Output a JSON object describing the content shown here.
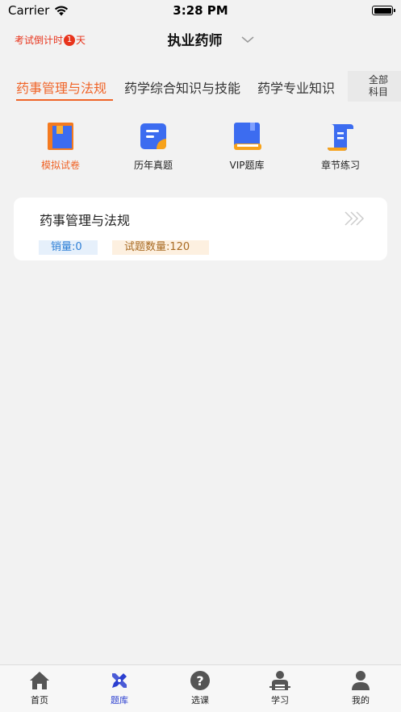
{
  "status_bar": {
    "carrier": "Carrier",
    "time": "3:28 PM"
  },
  "header": {
    "countdown_prefix": "考试倒计时",
    "countdown_days": "1",
    "countdown_suffix": "天",
    "title": "执业药师",
    "accent_color": "#e8341c"
  },
  "tabs": {
    "items": [
      {
        "label": "药事管理与法规",
        "active": true
      },
      {
        "label": "药学综合知识与技能",
        "active": false
      },
      {
        "label": "药学专业知识",
        "active": false
      }
    ],
    "all_subjects_line1": "全部",
    "all_subjects_line2": "科目",
    "active_color": "#f06428"
  },
  "features": [
    {
      "label": "模拟试卷",
      "icon": "mock-exam-icon"
    },
    {
      "label": "历年真题",
      "icon": "past-exams-icon"
    },
    {
      "label": "VIP题库",
      "icon": "vip-bank-icon"
    },
    {
      "label": "章节练习",
      "icon": "chapter-practice-icon"
    }
  ],
  "card": {
    "title": "药事管理与法规",
    "sales": "销量:0",
    "question_count": "试题数量:120"
  },
  "tabbar": {
    "items": [
      {
        "label": "首页",
        "icon": "home-icon",
        "active": false
      },
      {
        "label": "题库",
        "icon": "question-bank-icon",
        "active": true
      },
      {
        "label": "选课",
        "icon": "question-mark-icon",
        "active": false
      },
      {
        "label": "学习",
        "icon": "study-icon",
        "active": false
      },
      {
        "label": "我的",
        "icon": "profile-icon",
        "active": false
      }
    ],
    "active_color": "#2b3fd0"
  }
}
